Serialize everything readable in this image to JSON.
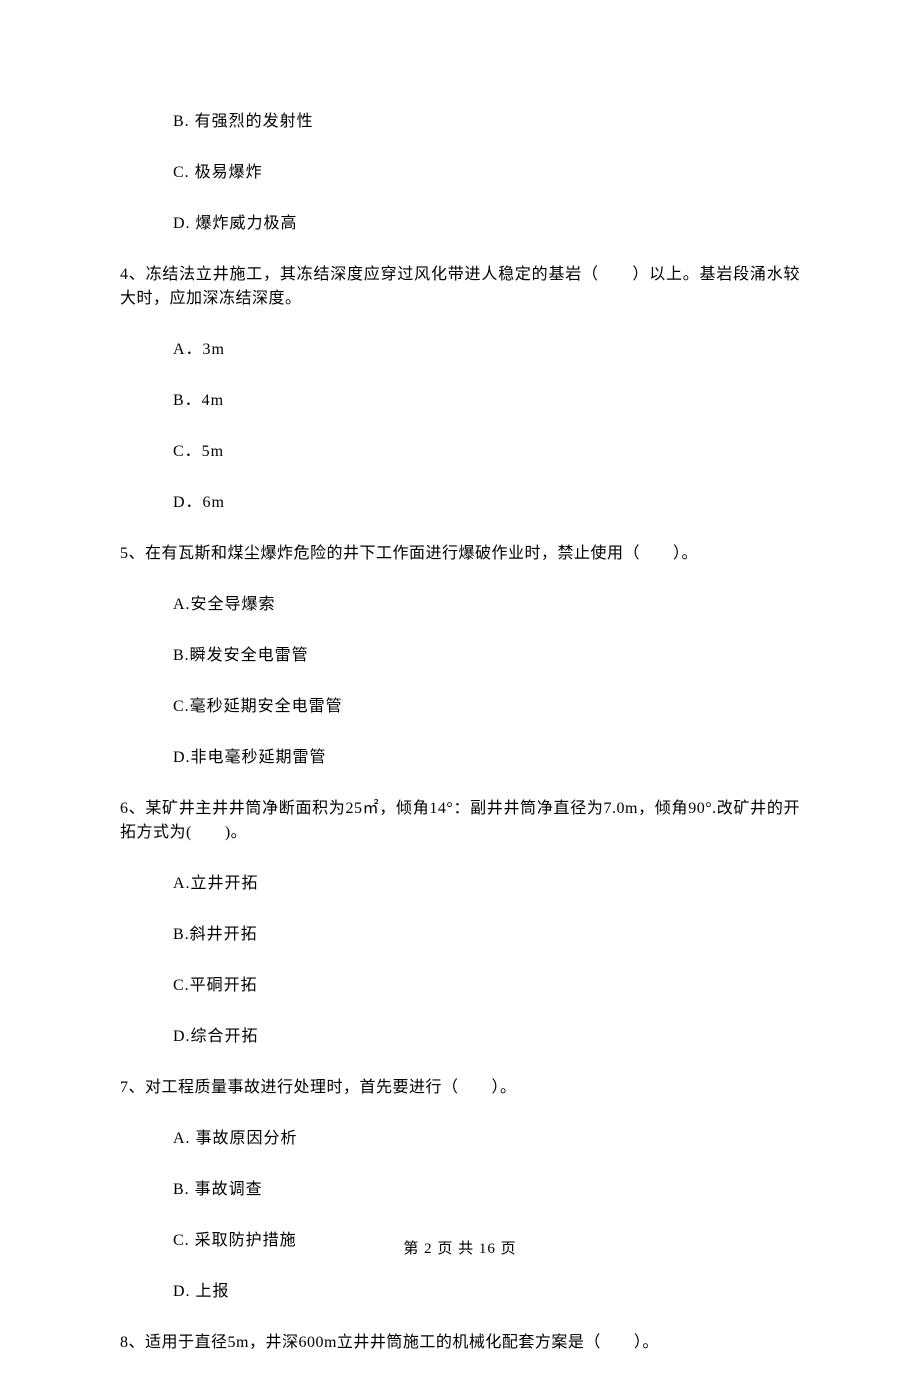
{
  "q3": {
    "optionB": "B. 有强烈的发射性",
    "optionC": "C. 极易爆炸",
    "optionD": "D. 爆炸威力极高"
  },
  "q4": {
    "text": "4、冻结法立井施工，其冻结深度应穿过风化带进人稳定的基岩（　　）以上。基岩段涌水较大时，应加深冻结深度。",
    "optionA": "A．3m",
    "optionB": "B．4m",
    "optionC": "C．5m",
    "optionD": "D．6m"
  },
  "q5": {
    "text": "5、在有瓦斯和煤尘爆炸危险的井下工作面进行爆破作业时，禁止使用（　　）。",
    "optionA": "A.安全导爆索",
    "optionB": "B.瞬发安全电雷管",
    "optionC": "C.毫秒延期安全电雷管",
    "optionD": "D.非电毫秒延期雷管"
  },
  "q6": {
    "text": "6、某矿井主井井筒净断面积为25㎡，倾角14°：副井井筒净直径为7.0m，倾角90°.改矿井的开拓方式为(　　)。",
    "optionA": "A.立井开拓",
    "optionB": "B.斜井开拓",
    "optionC": "C.平硐开拓",
    "optionD": "D.综合开拓"
  },
  "q7": {
    "text": "7、对工程质量事故进行处理时，首先要进行（　　）。",
    "optionA": "A. 事故原因分析",
    "optionB": "B. 事故调查",
    "optionC": "C. 采取防护措施",
    "optionD": "D. 上报"
  },
  "q8": {
    "text": "8、适用于直径5m，井深600m立井井筒施工的机械化配套方案是（　　）。"
  },
  "footer": "第 2 页 共 16 页"
}
